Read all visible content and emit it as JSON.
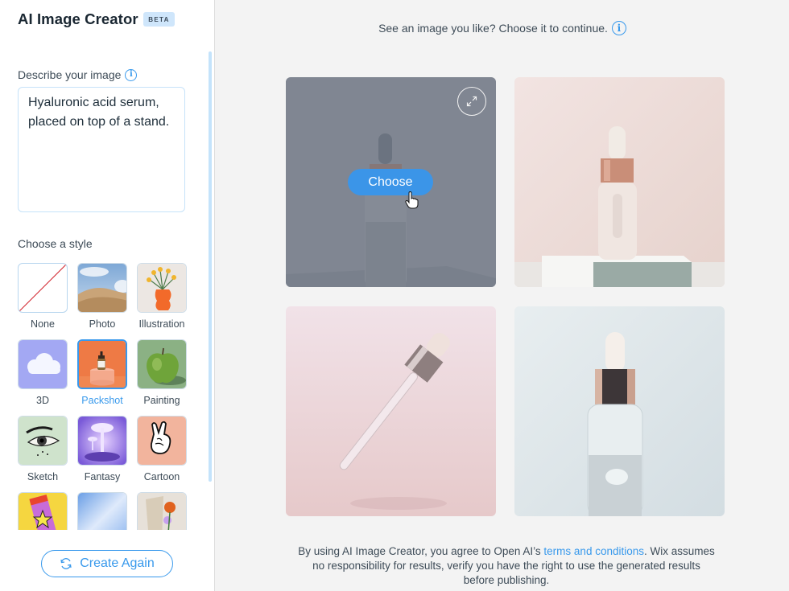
{
  "sidebar": {
    "title": "AI Image Creator",
    "badge": "BETA",
    "describe_label": "Describe your image",
    "prompt_value": "Hyaluronic acid serum, placed on top of a stand.",
    "style_label": "Choose a style",
    "styles": [
      {
        "label": "None",
        "selected": false
      },
      {
        "label": "Photo",
        "selected": false
      },
      {
        "label": "Illustration",
        "selected": false
      },
      {
        "label": "3D",
        "selected": false
      },
      {
        "label": "Packshot",
        "selected": true
      },
      {
        "label": "Painting",
        "selected": false
      },
      {
        "label": "Sketch",
        "selected": false
      },
      {
        "label": "Fantasy",
        "selected": false
      },
      {
        "label": "Cartoon",
        "selected": false
      }
    ],
    "create_again_label": "Create Again"
  },
  "main": {
    "hint": "See an image you like? Choose it to continue.",
    "choose_label": "Choose",
    "results": [
      {
        "description": "Serum dropper bottle on a stand, grey background",
        "hovered": true
      },
      {
        "description": "Clear serum bottle with rose-gold collar on white block, pink background",
        "hovered": false
      },
      {
        "description": "Floating glass dropper pipette, pink background",
        "hovered": false
      },
      {
        "description": "Serum bottle with droplet, pale blue background",
        "hovered": false
      }
    ],
    "disclaimer": {
      "before": "By using AI Image Creator, you agree to Open AI’s ",
      "link": "terms and conditions",
      "after": ". Wix assumes no responsibility for results, verify you have the right to use the generated results before publishing."
    }
  },
  "colors": {
    "accent": "#3899ec",
    "badge_bg": "#cfe6fb",
    "page_bg": "#f3f3f3"
  }
}
